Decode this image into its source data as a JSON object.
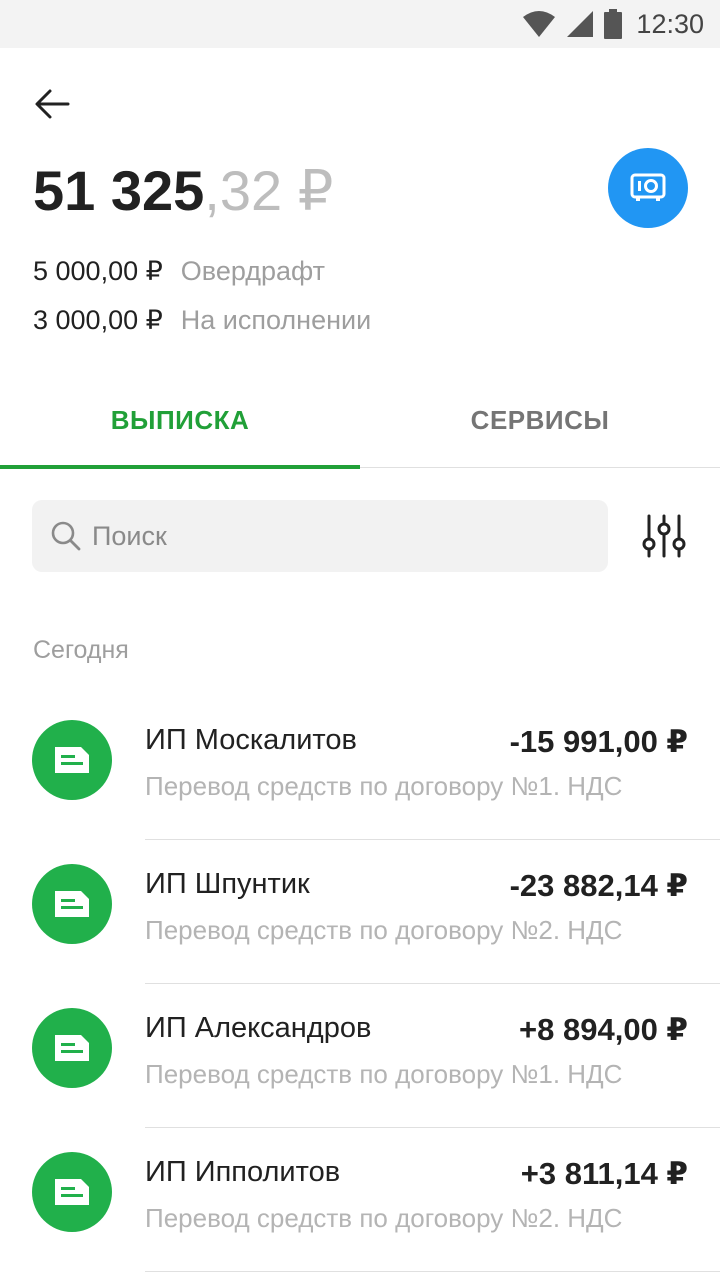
{
  "status_bar": {
    "time": "12:30"
  },
  "account": {
    "balance_int": "51 325",
    "balance_frac": ",32 ₽",
    "overdraft_amount": "5 000,00 ₽",
    "overdraft_label": "Овердрафт",
    "pending_amount": "3 000,00 ₽",
    "pending_label": "На исполнении"
  },
  "tabs": [
    {
      "label": "ВЫПИСКА",
      "active": true
    },
    {
      "label": "СЕРВИСЫ",
      "active": false
    }
  ],
  "search": {
    "placeholder": "Поиск",
    "value": ""
  },
  "section": {
    "title": "Сегодня"
  },
  "transactions": [
    {
      "name": "ИП Москалитов",
      "amount": "-15 991,00 ₽",
      "description": "Перевод средств по договору №1. НДС"
    },
    {
      "name": "ИП Шпунтик",
      "amount": "-23 882,14 ₽",
      "description": "Перевод средств по договору №2. НДС"
    },
    {
      "name": "ИП Александров",
      "amount": "+8 894,00 ₽",
      "description": "Перевод средств по договору №1. НДС"
    },
    {
      "name": "ИП Ипполитов",
      "amount": "+3 811,14 ₽",
      "description": "Перевод средств по договору №2. НДС"
    }
  ],
  "icons": {
    "back": "arrow-left-icon",
    "safe": "safe-icon",
    "search": "search-icon",
    "filter": "filter-sliders-icon",
    "transaction": "document-icon",
    "wifi": "wifi-icon",
    "signal": "signal-icon",
    "battery": "battery-icon"
  },
  "colors": {
    "accent_green": "#21a038",
    "icon_green": "#21b04b",
    "safe_blue": "#2196f3"
  }
}
